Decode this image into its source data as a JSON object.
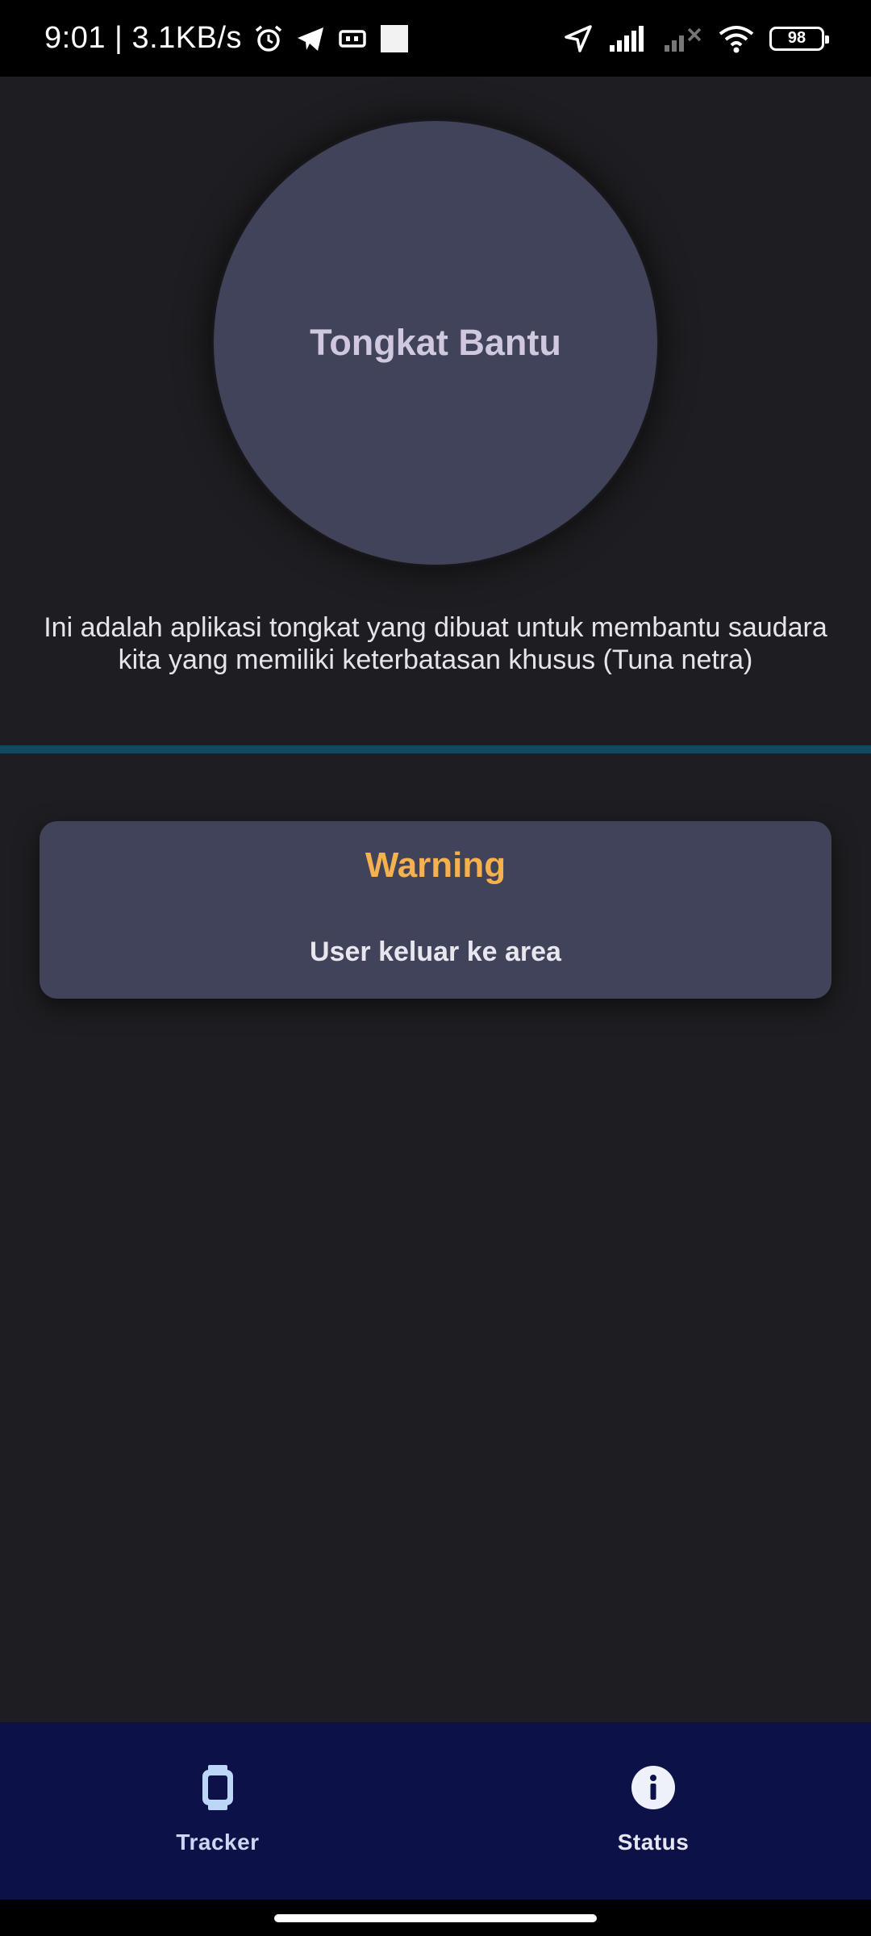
{
  "status_bar": {
    "time_speed": "9:01 | 3.1KB/s",
    "battery": "98"
  },
  "hero": {
    "title": "Tongkat Bantu"
  },
  "description": "Ini adalah aplikasi tongkat yang dibuat untuk membantu saudara kita yang memiliki keterbatasan khusus (Tuna netra)",
  "warning": {
    "title": "Warning",
    "message": "User keluar ke area"
  },
  "bottom_nav": {
    "items": [
      {
        "label": "Tracker",
        "icon": "watch-icon",
        "active": true
      },
      {
        "label": "Status",
        "icon": "info-icon",
        "active": false
      }
    ]
  },
  "colors": {
    "background": "#1e1e22",
    "card": "#41435a",
    "accent_warning": "#f6b14e",
    "divider": "#0f4a5e",
    "nav_background": "#0c1248"
  }
}
